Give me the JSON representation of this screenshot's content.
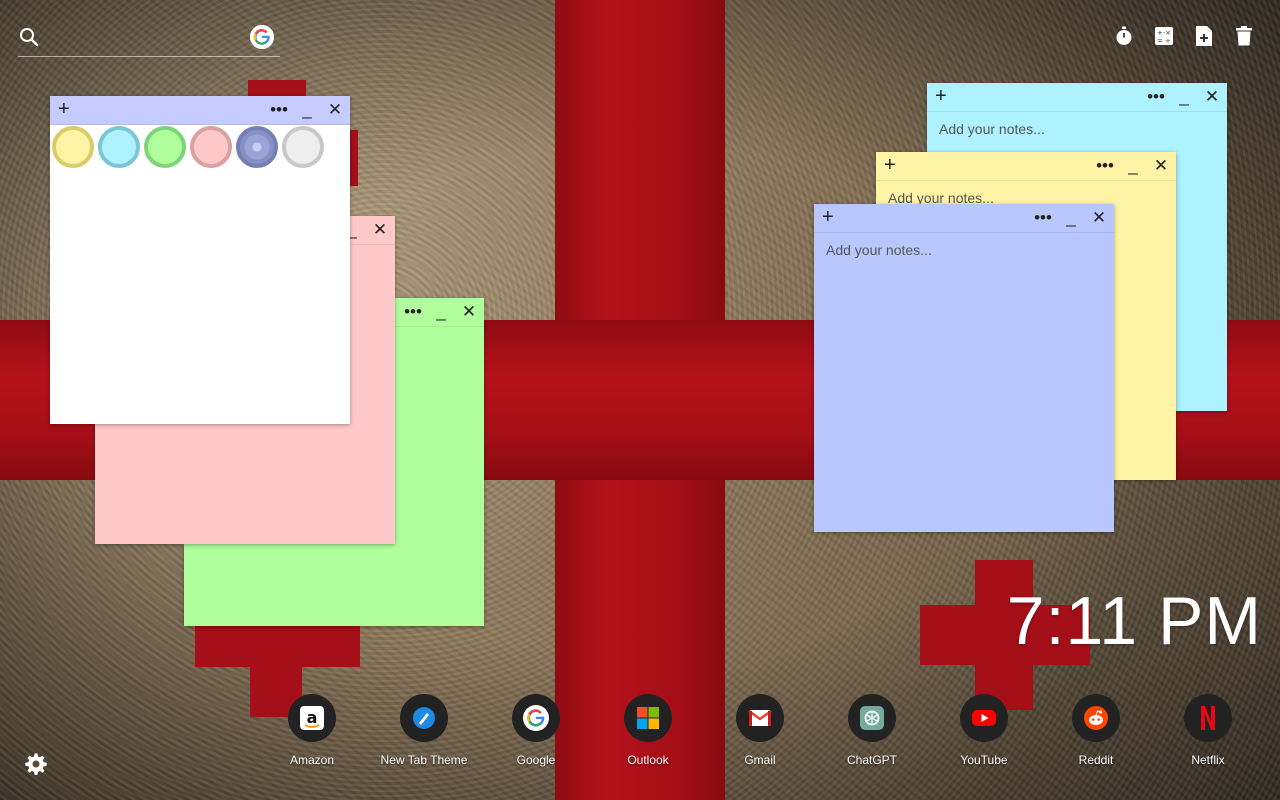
{
  "search": {
    "placeholder": "",
    "value": "",
    "icon": "search-icon",
    "engine_badge": "google-icon"
  },
  "toolbar": {
    "icons": [
      "stopwatch-icon",
      "calculator-icon",
      "add-note-icon",
      "trash-icon"
    ]
  },
  "notes": [
    {
      "id": "white-note",
      "color": "#ffffff",
      "bar_color": "#c5cbff",
      "placeholder": "",
      "controls": {
        "add": "+",
        "more": "•••",
        "minimize": "_",
        "close": "✕"
      }
    },
    {
      "id": "pink-note",
      "color": "#ffc9c9",
      "bar_color": "#ffc9c9",
      "placeholder": "",
      "controls": {
        "more": "•••",
        "minimize": "_",
        "close": "✕"
      }
    },
    {
      "id": "green-note",
      "color": "#b0ff9c",
      "bar_color": "#b0ff9c",
      "placeholder": "",
      "controls": {
        "more": "•••",
        "minimize": "_",
        "close": "✕"
      }
    },
    {
      "id": "cyan-note",
      "color": "#aef1ff",
      "bar_color": "#aef1ff",
      "placeholder": "Add your notes...",
      "controls": {
        "add": "+",
        "more": "•••",
        "minimize": "_",
        "close": "✕"
      }
    },
    {
      "id": "yellow-note",
      "color": "#fff3a6",
      "bar_color": "#fff3a6",
      "placeholder": "Add your notes...",
      "controls": {
        "add": "+",
        "more": "•••",
        "minimize": "_",
        "close": "✕"
      }
    },
    {
      "id": "blue-note",
      "color": "#b9c7ff",
      "bar_color": "#b9c7ff",
      "placeholder": "Add your notes...",
      "controls": {
        "add": "+",
        "more": "•••",
        "minimize": "_",
        "close": "✕"
      }
    }
  ],
  "color_swatches": [
    {
      "name": "yellow",
      "fill": "#fff3a6",
      "ring": "#d9cc6b"
    },
    {
      "name": "cyan",
      "fill": "#aef1ff",
      "ring": "#7cc7d6"
    },
    {
      "name": "green",
      "fill": "#b0ff9c",
      "ring": "#7fd47a"
    },
    {
      "name": "pink",
      "fill": "#ffc9c9",
      "ring": "#dba0a0"
    },
    {
      "name": "blue",
      "fill": "#9aa4d6",
      "ring": "#7680b5",
      "selected": true
    },
    {
      "name": "white",
      "fill": "#eeeeee",
      "ring": "#c8c8c8"
    }
  ],
  "clock": {
    "time": "7:11 PM"
  },
  "dock": {
    "apps": [
      {
        "label": "Amazon",
        "icon": "amazon-icon"
      },
      {
        "label": "New Tab Theme",
        "icon": "new-tab-theme-icon"
      },
      {
        "label": "Google",
        "icon": "google-icon"
      },
      {
        "label": "Outlook",
        "icon": "outlook-icon"
      },
      {
        "label": "Gmail",
        "icon": "gmail-icon"
      },
      {
        "label": "ChatGPT",
        "icon": "chatgpt-icon"
      },
      {
        "label": "YouTube",
        "icon": "youtube-icon"
      },
      {
        "label": "Reddit",
        "icon": "reddit-icon"
      },
      {
        "label": "Netflix",
        "icon": "netflix-icon"
      }
    ]
  },
  "settings": {
    "icon": "gear-icon"
  }
}
